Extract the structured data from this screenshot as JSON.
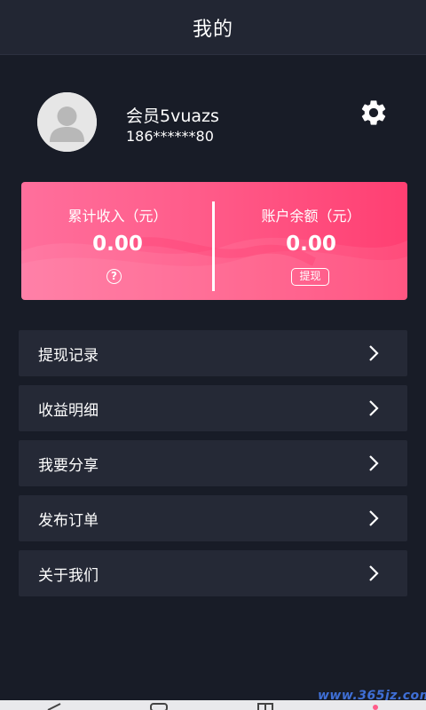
{
  "header": {
    "title": "我的"
  },
  "profile": {
    "username": "会员5vuazs",
    "phone": "186******80",
    "avatar_icon": "default-user-avatar",
    "settings_icon": "gear-icon"
  },
  "earnings": {
    "total_income_label": "累计收入（元）",
    "total_income_value": "0.00",
    "help_icon": "?",
    "balance_label": "账户余额（元）",
    "balance_value": "0.00",
    "withdraw_label": "提现",
    "gradient_start": "#ff6f9c",
    "gradient_end": "#ff3f72"
  },
  "menu": {
    "items": [
      {
        "label": "提现记录"
      },
      {
        "label": "收益明细"
      },
      {
        "label": "我要分享"
      },
      {
        "label": "发布订单"
      },
      {
        "label": "关于我们"
      }
    ]
  },
  "watermark": "www.365jz.com",
  "colors": {
    "background": "#181c27",
    "topbar": "#222633",
    "menu_item": "#252936",
    "accent": "#ff4f7f"
  }
}
